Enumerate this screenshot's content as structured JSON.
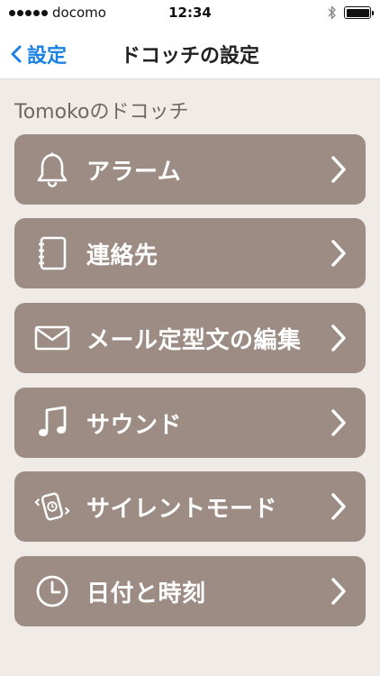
{
  "status_bar": {
    "carrier": "docomo",
    "time": "12:34"
  },
  "nav": {
    "back_label": "設定",
    "title": "ドコッチの設定"
  },
  "section": {
    "header": "Tomokoのドコッチ"
  },
  "menu": {
    "items": [
      {
        "label": "アラーム",
        "icon": "bell-icon"
      },
      {
        "label": "連絡先",
        "icon": "address-book-icon"
      },
      {
        "label": "メール定型文の編集",
        "icon": "envelope-icon"
      },
      {
        "label": "サウンド",
        "icon": "music-note-icon"
      },
      {
        "label": "サイレントモード",
        "icon": "silent-vibrate-icon"
      },
      {
        "label": "日付と時刻",
        "icon": "clock-icon"
      }
    ]
  },
  "colors": {
    "accent": "#1a82e2",
    "menu_background": "#9c8c84",
    "page_background": "#f0ebe6"
  }
}
